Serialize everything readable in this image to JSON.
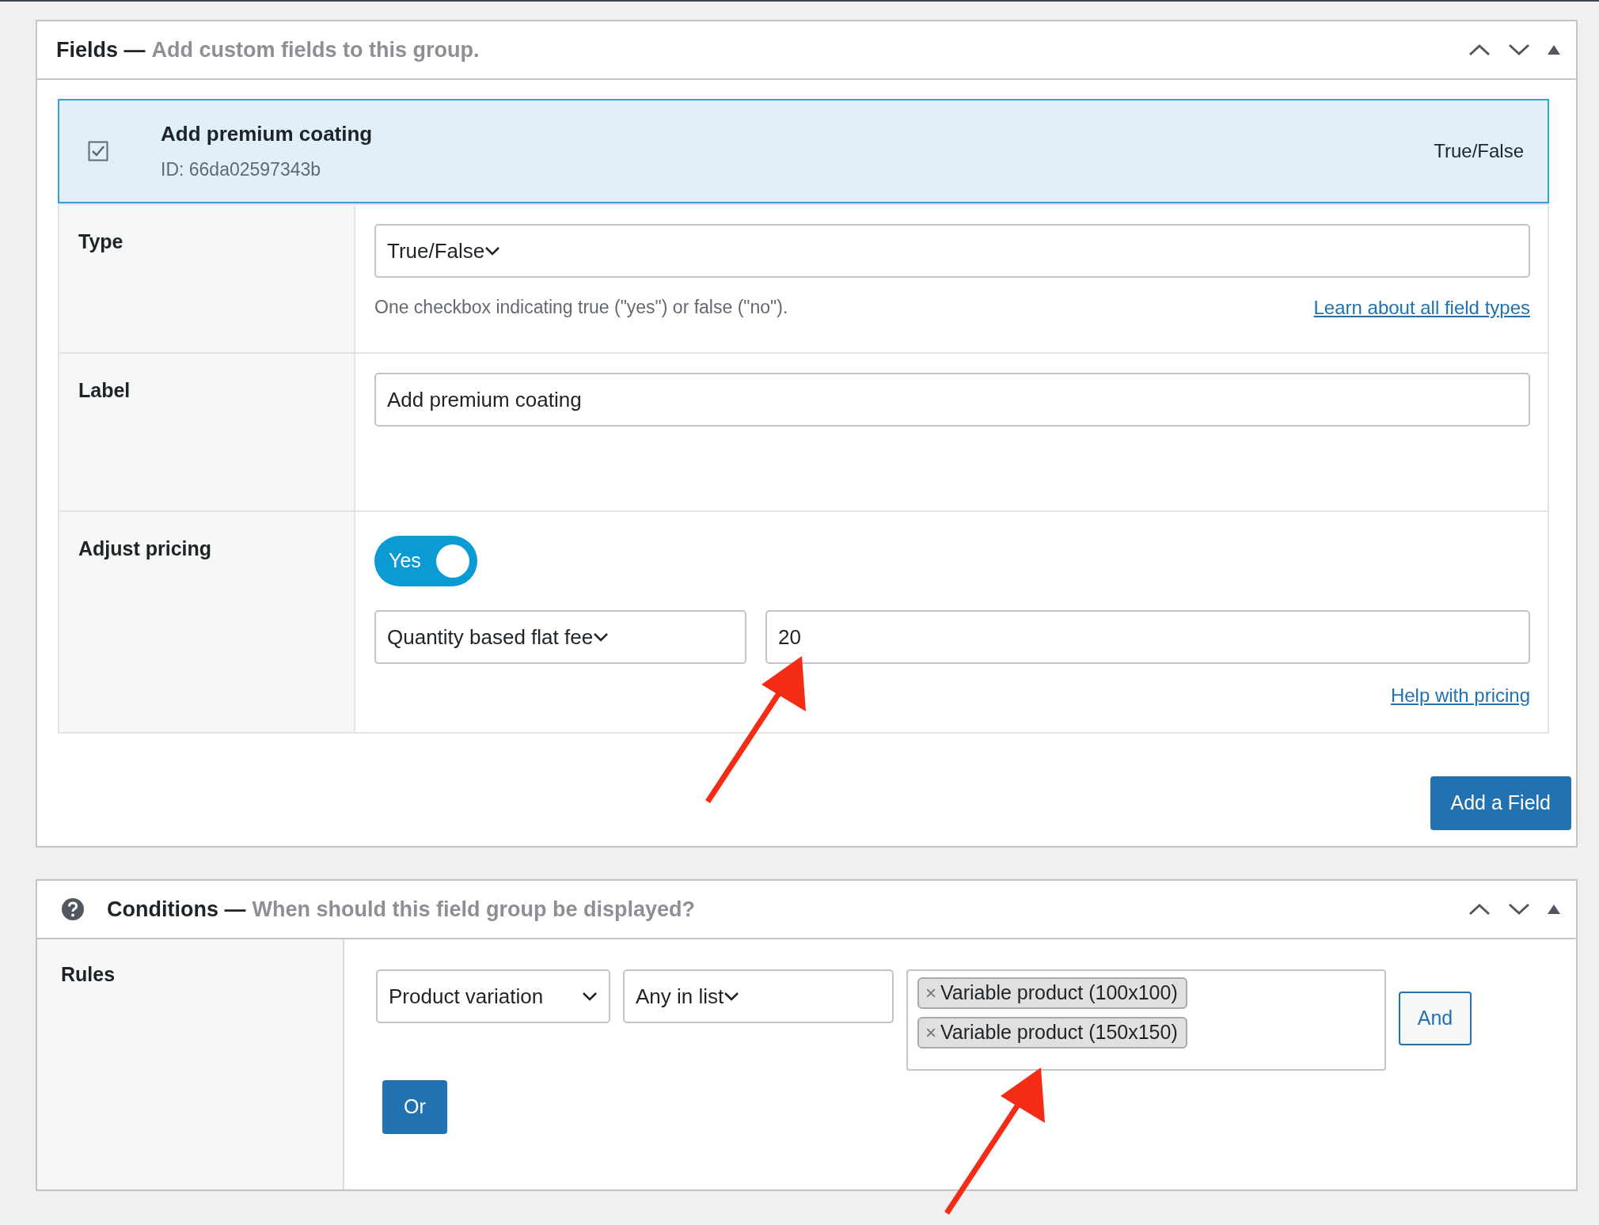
{
  "fields_panel": {
    "title": "Fields —",
    "subtitle": "Add custom fields to this group.",
    "field": {
      "label": "Add premium coating",
      "id": "ID: 66da02597343b",
      "type": "True/False",
      "selected": true
    },
    "settings": [
      {
        "kind": "select",
        "label": "Type",
        "value": "True/False",
        "description": "One checkbox indicating true (\"yes\") or false (\"no\").",
        "link": "Learn about all field types"
      },
      {
        "kind": "text",
        "label": "Label",
        "value": "Add premium coating"
      },
      {
        "kind": "pricing",
        "label": "Adjust pricing",
        "toggle": {
          "label": "Yes",
          "on": true
        },
        "method": "Quantity based flat fee",
        "amount": "20",
        "link": "Help with pricing"
      }
    ],
    "add_button": "Add a Field"
  },
  "conditions_panel": {
    "title": "Conditions —",
    "subtitle": "When should this field group be displayed?",
    "rules_label": "Rules",
    "rule": {
      "param": "Product variation",
      "operator": "Any in list",
      "values": [
        {
          "remove": "×",
          "label": "Variable product (100x100)"
        },
        {
          "remove": "×",
          "label": "Variable product (150x150)"
        }
      ],
      "and_button": "And"
    },
    "or_button": "Or"
  }
}
